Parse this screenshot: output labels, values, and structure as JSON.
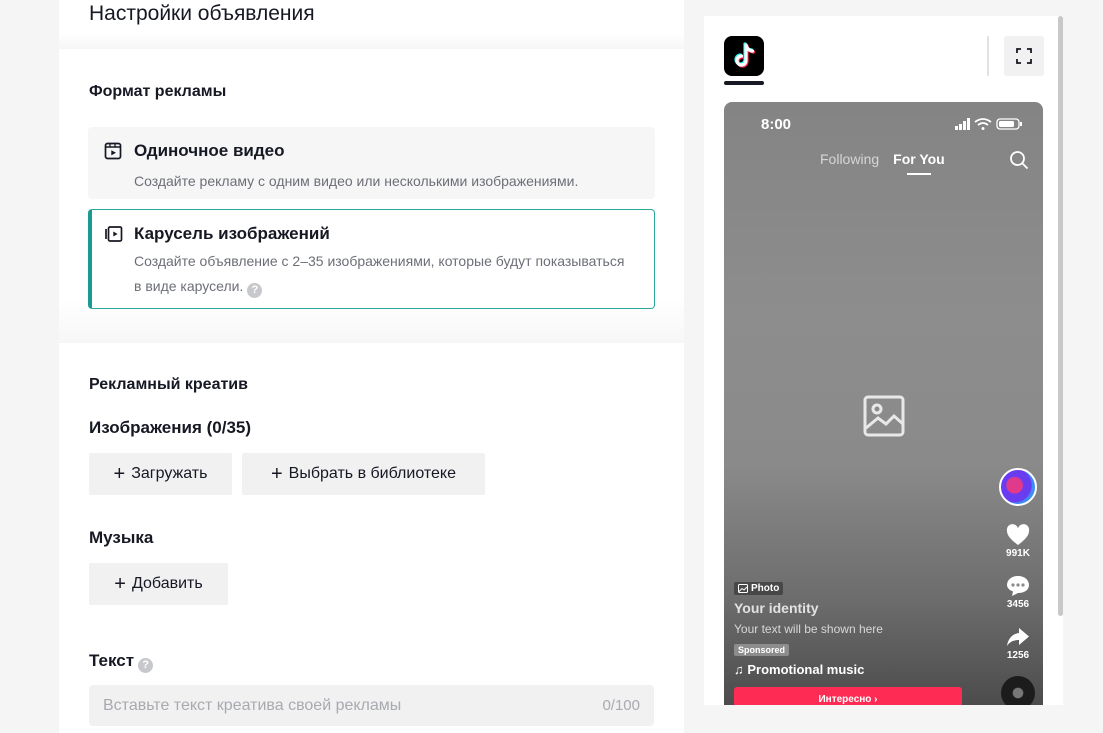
{
  "page": {
    "title": "Настройки объявления"
  },
  "format": {
    "section_title": "Формат рекламы",
    "options": [
      {
        "icon": "single-video-icon",
        "title": "Одиночное видео",
        "description": "Создайте рекламу с одним видео или несколькими изображениями.",
        "selected": false
      },
      {
        "icon": "carousel-icon",
        "title": "Карусель изображений",
        "description": "Создайте объявление с 2–35 изображениями, которые будут показываться в виде карусели.",
        "selected": true
      }
    ],
    "help_glyph": "?"
  },
  "creative": {
    "section_title": "Рекламный креатив",
    "images_label": "Изображения (0/35)",
    "upload_button": "Загружать",
    "library_button": "Выбрать в библиотеке",
    "music_label": "Музыка",
    "add_button": "Добавить",
    "text_label": "Текст",
    "text_placeholder": "Вставьте текст креатива своей рекламы",
    "text_counter": "0/100",
    "plus_glyph": "+"
  },
  "preview": {
    "status_time": "8:00",
    "tab_following": "Following",
    "tab_foryou": "For You",
    "likes": "991K",
    "comments": "3456",
    "shares": "1256",
    "photo_badge": "Photo",
    "identity": "Your identity",
    "caption": "Your text will be shown here",
    "sponsored": "Sponsored",
    "music": "♫ Promotional music",
    "cta": "Интересно ›"
  },
  "colors": {
    "accent": "#1a9b8f",
    "cta": "#fe2c55"
  }
}
